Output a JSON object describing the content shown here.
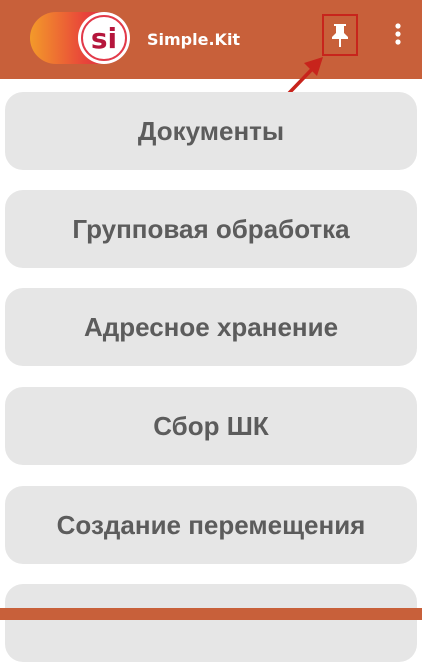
{
  "app": {
    "title": "Simple.Kit",
    "logo_text": "si"
  },
  "toolbar": {
    "pin_icon": "pin-icon",
    "menu_icon": "more-vert-icon"
  },
  "menu": {
    "items": [
      {
        "label": "Документы"
      },
      {
        "label": "Групповая обработка"
      },
      {
        "label": "Адресное хранение"
      },
      {
        "label": "Сбор ШК"
      },
      {
        "label": "Создание перемещения"
      },
      {
        "label": ""
      }
    ]
  },
  "colors": {
    "appbar": "#c8603a",
    "button_bg": "#e6e6e6",
    "button_text": "#5c5c5c",
    "annotation_red": "#c8241c"
  }
}
